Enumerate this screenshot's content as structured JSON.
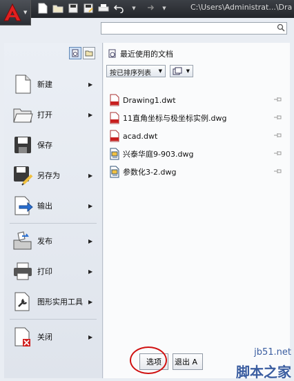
{
  "window": {
    "title": "C:\\Users\\Administrat...\\Dra"
  },
  "search": {
    "placeholder": ""
  },
  "menu": [
    {
      "id": "new",
      "label": "新建",
      "has_submenu": true,
      "icon": "new-document-icon"
    },
    {
      "id": "open",
      "label": "打开",
      "has_submenu": true,
      "icon": "open-folder-icon"
    },
    {
      "id": "save",
      "label": "保存",
      "has_submenu": false,
      "icon": "save-disk-icon"
    },
    {
      "id": "saveas",
      "label": "另存为",
      "has_submenu": true,
      "icon": "save-as-icon"
    },
    {
      "id": "export",
      "label": "输出",
      "has_submenu": true,
      "icon": "export-icon"
    },
    {
      "id": "publish",
      "label": "发布",
      "has_submenu": true,
      "icon": "publish-icon"
    },
    {
      "id": "print",
      "label": "打印",
      "has_submenu": true,
      "icon": "printer-icon"
    },
    {
      "id": "utilities",
      "label": "图形实用工具",
      "has_submenu": true,
      "icon": "wrench-icon"
    },
    {
      "id": "close",
      "label": "关闭",
      "has_submenu": true,
      "icon": "close-document-icon"
    }
  ],
  "recent": {
    "heading": "最近使用的文档",
    "sort_label": "按已排序列表",
    "files": [
      {
        "name": "Drawing1.dwt",
        "type": "dwt"
      },
      {
        "name": "11直角坐标与极坐标实例.dwg",
        "type": "dwg"
      },
      {
        "name": "acad.dwt",
        "type": "dwt"
      },
      {
        "name": "兴泰华庭9-903.dwg",
        "type": "dwg"
      },
      {
        "name": "参数化3-2.dwg",
        "type": "dwg"
      }
    ]
  },
  "buttons": {
    "options": "选项",
    "exit": "退出 A"
  },
  "watermark": {
    "site": "jb51.net",
    "brand": "脚本之家"
  },
  "colors": {
    "accent_red": "#d01010",
    "titlebar": "#2b2e33"
  }
}
